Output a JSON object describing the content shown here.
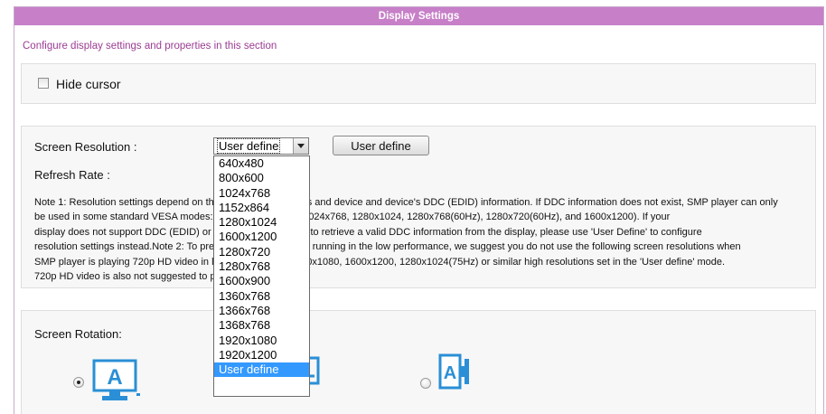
{
  "panel": {
    "title": "Display Settings",
    "subtitle": "Configure display settings and properties in this section"
  },
  "hide_cursor": {
    "label": "Hide cursor",
    "checked": false
  },
  "resolution": {
    "label": "Screen Resolution :",
    "selected": "User define",
    "button_label": "User define",
    "refresh_label": "Refresh Rate :",
    "note_lines": [
      "Note 1: Resolution settings depend on the display's capabilities and device and device's DDC (EDID) information. If DDC information does not exist, SMP player can only",
      "be used in some standard VESA modes: 640x480, 800x600, 1024x768, 1280x1024, 1280x768(60Hz), 1280x720(60Hz), and 1600x1200). If your",
      "display does not support DDC (EDID) or SMP player is unable to retrieve a valid DDC information from the display, please use 'User Define' to configure",
      "resolution settings instead.Note 2: To prevent SMP player from running in the low performance, we suggest you do not use the following screen resolutions when",
      "SMP player is playing 720p HD video in landscape mode: 1920x1080, 1600x1200, 1280x1024(75Hz) or similar high resolutions set in the 'User define' mode.",
      "720p HD video is also not suggested to play in portrait mode."
    ],
    "options": [
      "640x480",
      "800x600",
      "1024x768",
      "1152x864",
      "1280x1024",
      "1600x1200",
      "1280x720",
      "1280x768",
      "1600x900",
      "1360x768",
      "1366x768",
      "1368x768",
      "1920x1080",
      "1920x1200",
      "User define"
    ],
    "highlighted_option": "User define"
  },
  "rotation": {
    "label": "Screen Rotation:",
    "icon_color": "#2a8fd6",
    "options": [
      {
        "icon": "monitor-landscape-icon",
        "selected": true
      },
      {
        "icon": "monitor-portrait-icon",
        "selected": false
      },
      {
        "icon": "monitor-portrait-right-icon",
        "selected": false
      }
    ]
  }
}
